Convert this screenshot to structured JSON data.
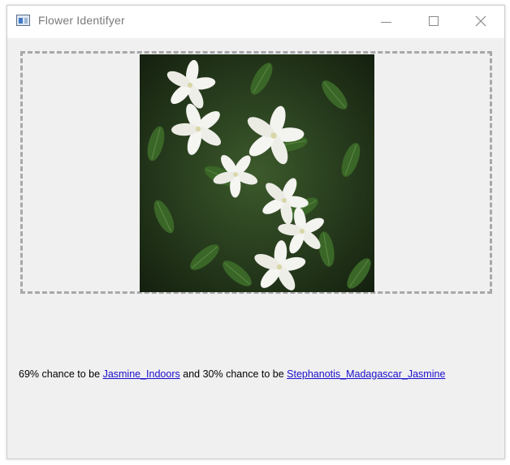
{
  "window": {
    "title": "Flower Identifyer",
    "controls": [
      "minimize-icon",
      "maximize-icon",
      "close-icon"
    ]
  },
  "image": {
    "subject": "white jasmine flowers",
    "colors": {
      "foliage": "#2d4a22",
      "petal": "#f4f4f0"
    }
  },
  "result": {
    "prediction_1": {
      "percent": "69%",
      "text_before": " chance to be ",
      "link": "Jasmine_Indoors"
    },
    "connector": " and ",
    "prediction_2": {
      "percent": "30%",
      "text_before": " chance to be ",
      "link": "Stephanotis_Madagascar_Jasmine"
    }
  },
  "colors": {
    "window_bg": "#f0f0f0",
    "link": "#1a0dcc",
    "dash_border": "#a8a8a8"
  }
}
